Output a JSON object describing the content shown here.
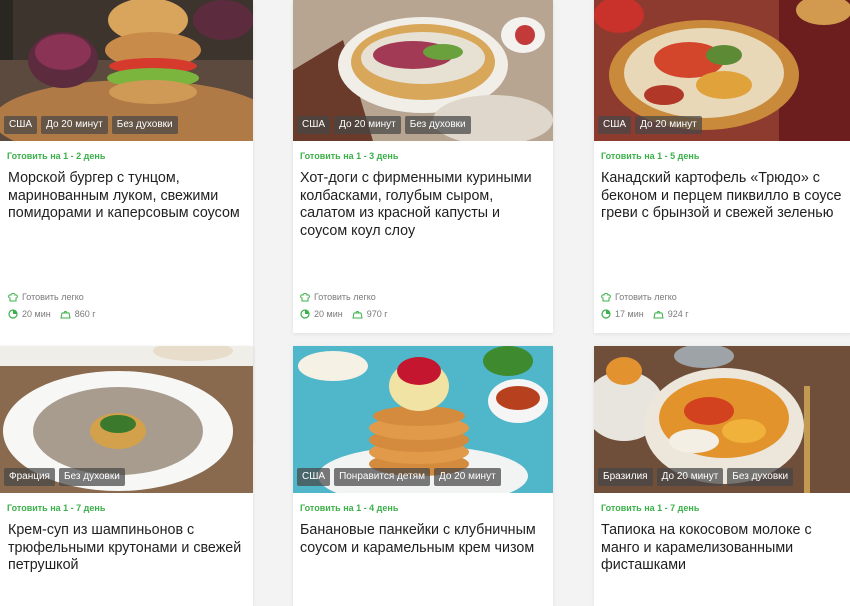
{
  "colors": {
    "accent": "#3cb04a",
    "tag_bg": "#4a4a4a",
    "page_bg": "#f3f3f3"
  },
  "cards": [
    {
      "tags": [
        "США",
        "До 20 минут",
        "Без духовки"
      ],
      "cook_time": "Готовить на 1 - 2 день",
      "title": "Морской бургер с тунцом, маринованным луком, свежими помидорами и каперсовым соусом",
      "difficulty": "Готовить легко",
      "time": "20 мин",
      "weight": "860 г",
      "photo": "burger"
    },
    {
      "tags": [
        "США",
        "До 20 минут",
        "Без духовки"
      ],
      "cook_time": "Готовить на 1 - 3 день",
      "title": "Хот-доги с фирменными куриными колбасками, голубым сыром, салатом из красной капусты и соусом коул слоу",
      "difficulty": "Готовить легко",
      "time": "20 мин",
      "weight": "970 г",
      "photo": "hotdog"
    },
    {
      "tags": [
        "США",
        "До 20 минут"
      ],
      "cook_time": "Готовить на 1 - 5 день",
      "title": "Канадский картофель «Трюдо» с беконом и перцем пиквилло в соусе греви с брынзой и свежей зеленью",
      "difficulty": "Готовить легко",
      "time": "17 мин",
      "weight": "924 г",
      "photo": "potato"
    },
    {
      "tags": [
        "Франция",
        "Без духовки"
      ],
      "cook_time": "Готовить на 1 - 7 день",
      "title": "Крем-суп из шампиньонов с трюфельными крутонами и свежей петрушкой",
      "photo": "soup"
    },
    {
      "tags": [
        "США",
        "Понравится детям",
        "До 20 минут"
      ],
      "cook_time": "Готовить на 1 - 4 день",
      "title": "Банановые панкейки с клубничным соусом и карамельным крем чизом",
      "photo": "pancakes"
    },
    {
      "tags": [
        "Бразилия",
        "До 20 минут",
        "Без духовки"
      ],
      "cook_time": "Готовить на 1 - 7 день",
      "title": "Тапиока на кокосовом молоке с манго и карамелизованными фисташками",
      "photo": "tapioca"
    }
  ]
}
